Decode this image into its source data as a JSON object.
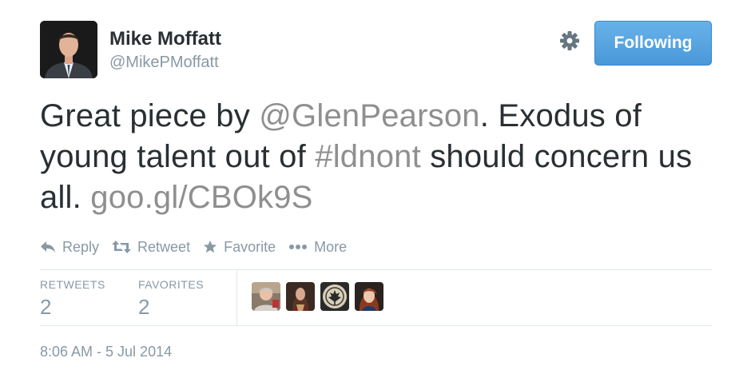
{
  "user": {
    "name": "Mike Moffatt",
    "handle": "@MikePMoffatt",
    "follow_label": "Following"
  },
  "tweet": {
    "text_1": "Great piece by ",
    "mention": "@GlenPearson",
    "text_2": ". Exodus of young talent out of ",
    "hashtag": "#ldnont",
    "text_3": " should concern us all. ",
    "url": "goo.gl/CBOk9S"
  },
  "actions": {
    "reply": "Reply",
    "retweet": "Retweet",
    "favorite": "Favorite",
    "more": "More"
  },
  "stats": {
    "retweets_label": "RETWEETS",
    "retweets_count": "2",
    "favorites_label": "FAVORITES",
    "favorites_count": "2"
  },
  "timestamp": "8:06 AM - 5 Jul 2014",
  "colors": {
    "link": "#8f8f8f",
    "follow_button": "#55a2e0",
    "muted": "#8899a6"
  }
}
